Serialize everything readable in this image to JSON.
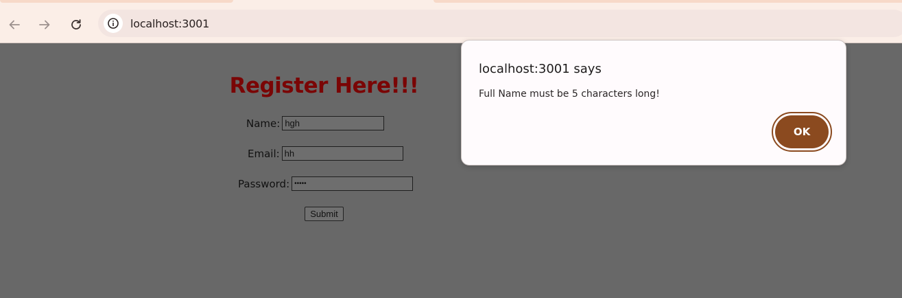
{
  "browser": {
    "url": "localhost:3001",
    "icons": {
      "back": "arrow-left-icon",
      "forward": "arrow-right-icon",
      "reload": "reload-icon",
      "site_info": "info-icon"
    }
  },
  "form": {
    "heading": "Register Here!!!",
    "name_label": "Name:",
    "name_value": "hgh",
    "email_label": "Email:",
    "email_value": "hh",
    "password_label": "Password:",
    "password_value": "•••••",
    "submit_label": "Submit"
  },
  "alert": {
    "title": "localhost:3001 says",
    "message": "Full Name must be 5 characters long!",
    "ok_label": "OK"
  },
  "colors": {
    "overlay": "#686868",
    "heading": "#7a0505",
    "ok_button": "#8b4a1f",
    "chrome_bg": "#fbeee7",
    "omnibox_bg": "#f3e5e1"
  }
}
